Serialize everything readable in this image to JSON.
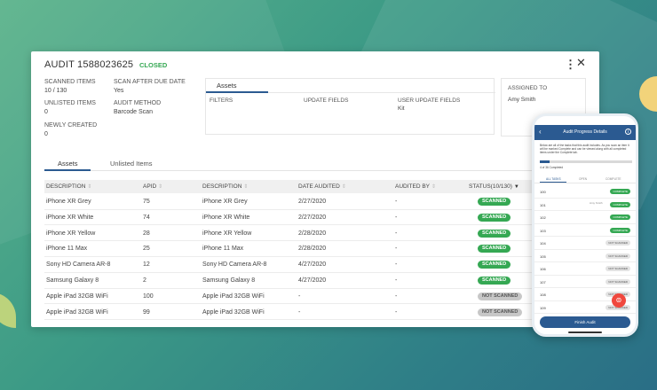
{
  "audit": {
    "title": "AUDIT 1588023625",
    "status": "CLOSED",
    "more_icon": "⋮",
    "close_icon": "✕"
  },
  "meta": {
    "scanned_items_label": "SCANNED ITEMS",
    "scanned_items_value": "10 / 130",
    "unlisted_items_label": "UNLISTED ITEMS",
    "unlisted_items_value": "0",
    "newly_created_label": "NEWLY CREATED",
    "newly_created_value": "0",
    "scan_after_due_label": "SCAN AFTER DUE DATE",
    "scan_after_due_value": "Yes",
    "audit_method_label": "AUDIT METHOD",
    "audit_method_value": "Barcode Scan"
  },
  "assets_panel": {
    "tab_label": "Assets",
    "filters_label": "FILTERS",
    "update_fields_label": "UPDATE FIELDS",
    "user_update_fields_label": "USER UPDATE FIELDS",
    "user_update_fields_value": "Kit"
  },
  "assigned": {
    "label": "ASSIGNED TO",
    "value": "Amy Smith"
  },
  "tabs": [
    "Assets",
    "Unlisted Items"
  ],
  "table": {
    "headers": [
      "DESCRIPTION",
      "APID",
      "DESCRIPTION",
      "DATE AUDITED",
      "AUDITED BY",
      "STATUS(10/130)"
    ],
    "rows": [
      {
        "desc": "iPhone XR Grey",
        "apid": "75",
        "desc2": "iPhone XR Grey",
        "date": "2/27/2020",
        "by": "-",
        "status": "SCANNED"
      },
      {
        "desc": "iPhone XR White",
        "apid": "74",
        "desc2": "iPhone XR White",
        "date": "2/27/2020",
        "by": "-",
        "status": "SCANNED"
      },
      {
        "desc": "iPhone XR Yellow",
        "apid": "28",
        "desc2": "iPhone XR Yellow",
        "date": "2/28/2020",
        "by": "-",
        "status": "SCANNED"
      },
      {
        "desc": "iPhone 11 Max",
        "apid": "25",
        "desc2": "iPhone 11 Max",
        "date": "2/28/2020",
        "by": "-",
        "status": "SCANNED"
      },
      {
        "desc": "Sony HD Camera AR-8",
        "apid": "12",
        "desc2": "Sony HD Camera AR-8",
        "date": "4/27/2020",
        "by": "-",
        "status": "SCANNED"
      },
      {
        "desc": "Samsung Galaxy 8",
        "apid": "2",
        "desc2": "Samsung Galaxy 8",
        "date": "4/27/2020",
        "by": "-",
        "status": "SCANNED"
      },
      {
        "desc": "Apple iPad 32GB WiFi",
        "apid": "100",
        "desc2": "Apple iPad 32GB WiFi",
        "date": "-",
        "by": "-",
        "status": "NOT SCANNED"
      },
      {
        "desc": "Apple iPad 32GB WiFi",
        "apid": "99",
        "desc2": "Apple iPad 32GB WiFi",
        "date": "-",
        "by": "-",
        "status": "NOT SCANNED"
      }
    ]
  },
  "phone": {
    "title": "Audit Progress Details",
    "description": "Below are all of the tasks that this audit includes. As you scan an item it will be marked Complete and can be viewed along with all completed items under the Complete tab.",
    "progress": 0.11,
    "count_text": "4 of 36 Completed",
    "tabs": [
      "ALL TASKS",
      "OPEN",
      "COMPLETE"
    ],
    "rows": [
      {
        "id": "100",
        "who": "",
        "status": "COMPLETE"
      },
      {
        "id": "101",
        "who": "Amy Smith",
        "status": "COMPLETE"
      },
      {
        "id": "102",
        "who": "",
        "status": "COMPLETE"
      },
      {
        "id": "103",
        "who": "",
        "status": "COMPLETE"
      },
      {
        "id": "104",
        "who": "",
        "status": "NOT SCANNED"
      },
      {
        "id": "105",
        "who": "",
        "status": "NOT SCANNED"
      },
      {
        "id": "106",
        "who": "",
        "status": "NOT SCANNED"
      },
      {
        "id": "107",
        "who": "",
        "status": "NOT SCANNED"
      },
      {
        "id": "108",
        "who": "",
        "status": "NOT SCANNED"
      },
      {
        "id": "109",
        "who": "",
        "status": "NOT SCANNED"
      }
    ],
    "finish_button": "Finish Audit",
    "fab_icon": "⊜"
  }
}
